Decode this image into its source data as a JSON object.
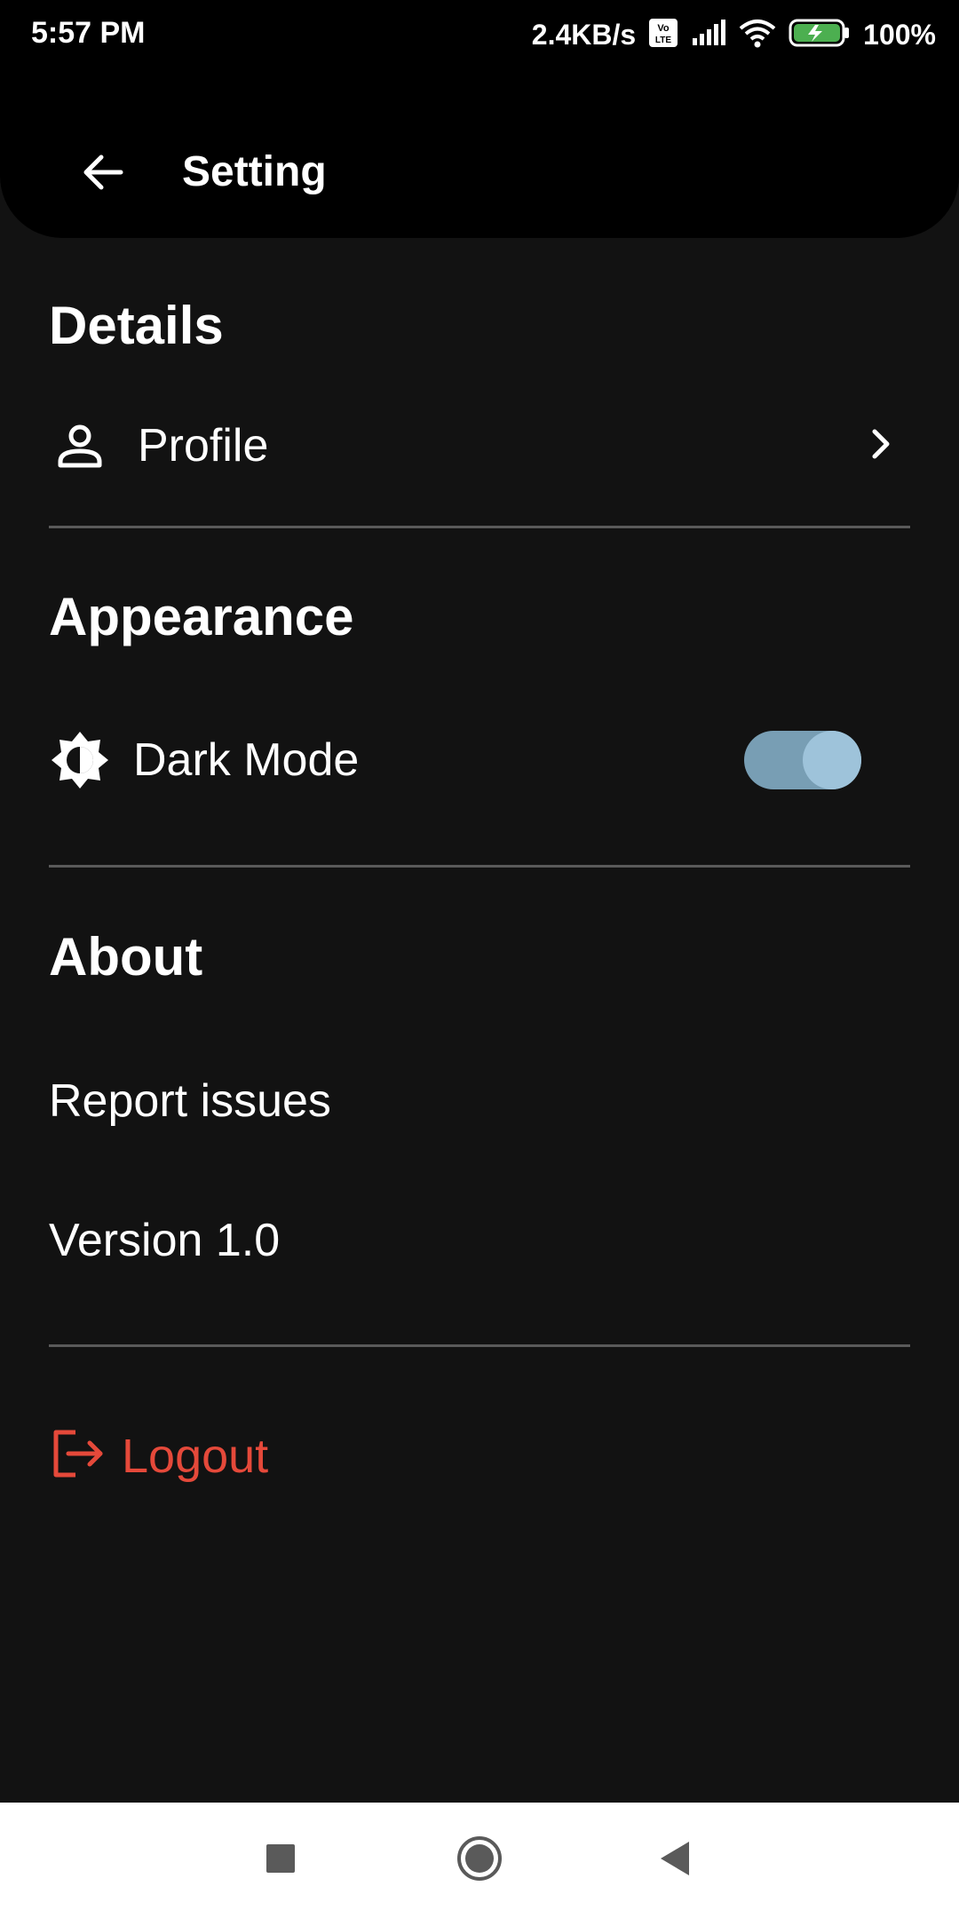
{
  "status_bar": {
    "time": "5:57 PM",
    "network_speed": "2.4KB/s",
    "battery": "100%"
  },
  "app_bar": {
    "title": "Setting"
  },
  "sections": {
    "details": {
      "title": "Details",
      "profile_label": "Profile"
    },
    "appearance": {
      "title": "Appearance",
      "dark_mode_label": "Dark Mode",
      "dark_mode_enabled": true
    },
    "about": {
      "title": "About",
      "report_issues_label": "Report issues",
      "version_label": "Version 1.0"
    }
  },
  "logout": {
    "label": "Logout"
  },
  "colors": {
    "background": "#121212",
    "app_bar": "#000000",
    "logout": "#e5493a",
    "toggle_track": "#789eb4",
    "toggle_knob": "#9ec3da"
  },
  "icons": {
    "back": "arrow-back-icon",
    "profile": "person-outline-icon",
    "chevron": "chevron-right-icon",
    "dark_mode": "brightness-icon",
    "logout": "logout-icon",
    "nav_recent": "square-icon",
    "nav_home": "circle-icon",
    "nav_back": "triangle-back-icon"
  }
}
